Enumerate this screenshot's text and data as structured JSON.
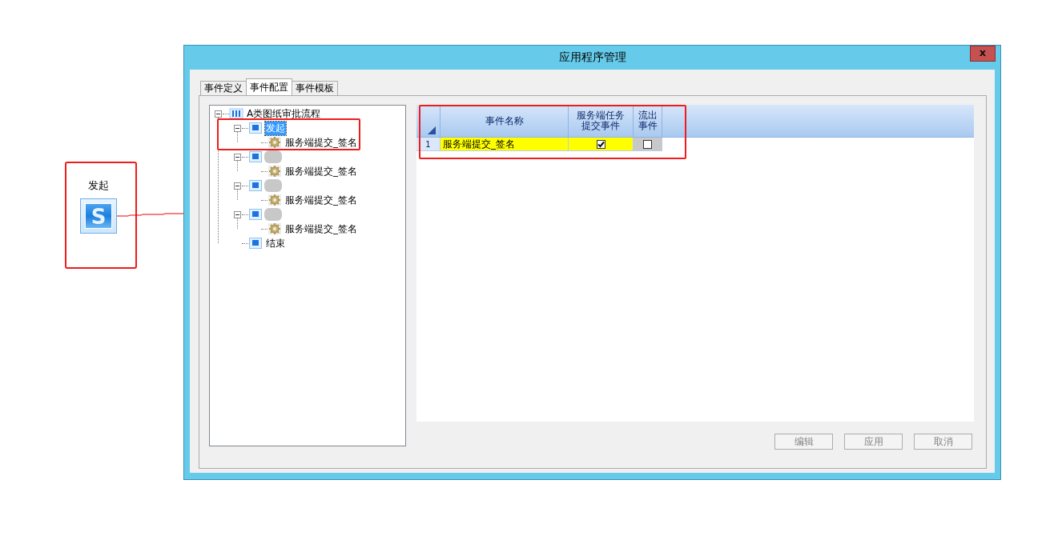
{
  "diagram_node": {
    "label": "发起",
    "icon_letter": "S"
  },
  "window": {
    "title": "应用程序管理",
    "close": "x"
  },
  "tabs": [
    {
      "label": "事件定义",
      "selected": false
    },
    {
      "label": "事件配置",
      "selected": true
    },
    {
      "label": "事件模板",
      "selected": false
    }
  ],
  "tree": [
    {
      "kind": "process",
      "label": "A类图纸审批流程",
      "expanded": true,
      "selected": false,
      "children": [
        {
          "kind": "step",
          "label": "发起",
          "expanded": true,
          "selected": true,
          "children": [
            {
              "kind": "event",
              "label": "服务端提交_签名",
              "selected": false
            }
          ]
        },
        {
          "kind": "step",
          "redacted": true,
          "expanded": true,
          "selected": false,
          "children": [
            {
              "kind": "event",
              "label": "服务端提交_签名",
              "selected": false
            }
          ]
        },
        {
          "kind": "step",
          "redacted": true,
          "expanded": true,
          "selected": false,
          "children": [
            {
              "kind": "event",
              "label": "服务端提交_签名",
              "selected": false
            }
          ]
        },
        {
          "kind": "step",
          "redacted": true,
          "expanded": true,
          "selected": false,
          "children": [
            {
              "kind": "event",
              "label": "服务端提交_签名",
              "selected": false
            }
          ]
        },
        {
          "kind": "step",
          "label": "结束",
          "selected": false
        }
      ]
    }
  ],
  "grid": {
    "columns": [
      "事件名称",
      "服务端任务提交事件",
      "流出事件"
    ],
    "rows": [
      {
        "number": "1",
        "name": "服务端提交_签名",
        "server_submit": true,
        "outflow": false
      }
    ]
  },
  "buttons": [
    {
      "label": "编辑",
      "disabled": true
    },
    {
      "label": "应用",
      "disabled": true
    },
    {
      "label": "取消",
      "disabled": true
    }
  ]
}
